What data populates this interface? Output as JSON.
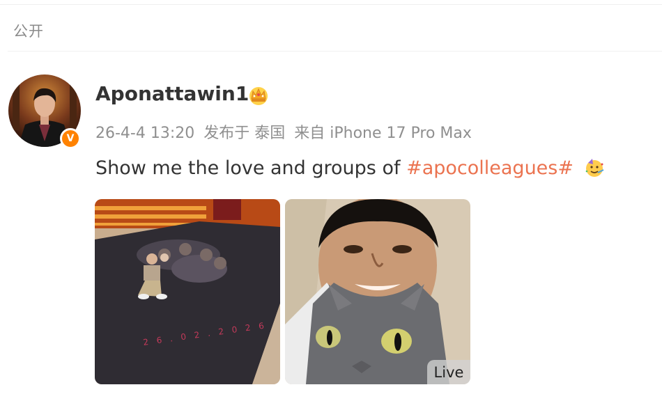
{
  "visibility": {
    "label": "公开"
  },
  "post": {
    "author": {
      "name": "Aponattawin1",
      "avatar": "profile-photo",
      "verified_badge": "V",
      "badge_icon": "crown-icon",
      "badge_color": "#ff8200"
    },
    "meta": {
      "time": "26-4-4 13:20",
      "location": "发布于 泰国",
      "source": "来自 iPhone 17 Pro Max"
    },
    "text": {
      "prefix": "Show me the love and groups of ",
      "hashtag": "#apocolleagues#",
      "emoji": "party-face-icon"
    },
    "images": [
      {
        "name": "floor-poster-photo",
        "poster_date": "2 6 . 0 2 . 2 0 2 6"
      },
      {
        "name": "selfie-with-cat-photo",
        "live_label": "Live"
      }
    ]
  },
  "colors": {
    "hashtag": "#eb7350",
    "meta": "#8f8f8f",
    "text": "#333333"
  }
}
